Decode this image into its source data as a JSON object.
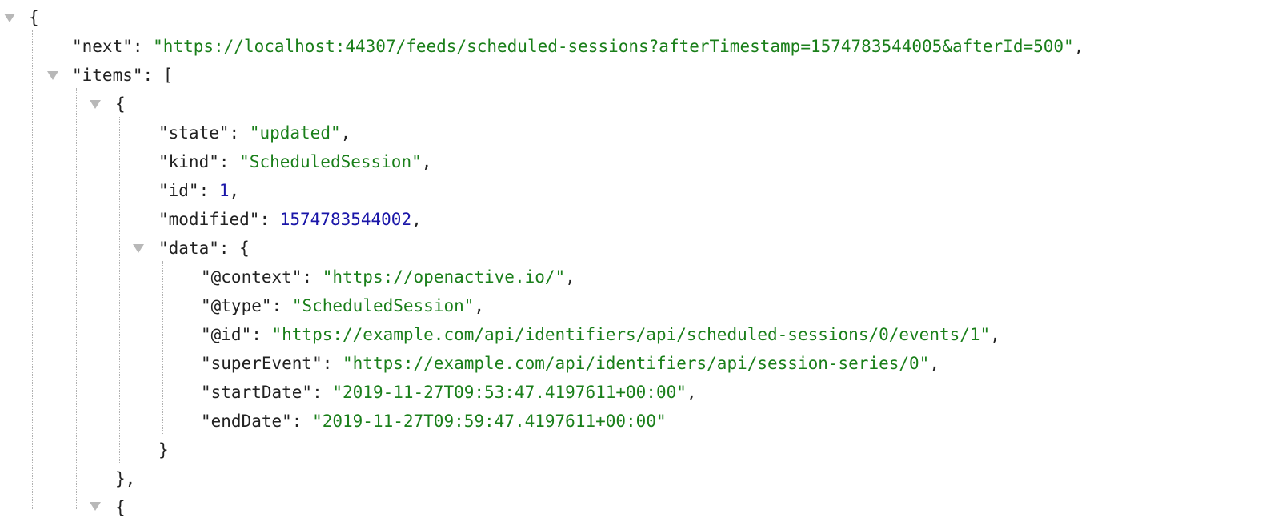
{
  "punct": {
    "open_brace": "{",
    "close_brace": "}",
    "close_brace_comma": "},",
    "open_bracket": "[",
    "colon": ": ",
    "comma": ","
  },
  "root": {
    "next_key": "\"next\"",
    "next_value": "\"https://localhost:44307/feeds/scheduled-sessions?afterTimestamp=1574783544005&afterId=500\"",
    "items_key": "\"items\""
  },
  "item": {
    "state_key": "\"state\"",
    "state_value": "\"updated\"",
    "kind_key": "\"kind\"",
    "kind_value": "\"ScheduledSession\"",
    "id_key": "\"id\"",
    "id_value": "1",
    "modified_key": "\"modified\"",
    "modified_value": "1574783544002",
    "data_key": "\"data\""
  },
  "data": {
    "context_key": "\"@context\"",
    "context_value": "\"https://openactive.io/\"",
    "type_key": "\"@type\"",
    "type_value": "\"ScheduledSession\"",
    "id_key": "\"@id\"",
    "id_value": "\"https://example.com/api/identifiers/api/scheduled-sessions/0/events/1\"",
    "superevent_key": "\"superEvent\"",
    "superevent_value": "\"https://example.com/api/identifiers/api/session-series/0\"",
    "startdate_key": "\"startDate\"",
    "startdate_value": "\"2019-11-27T09:53:47.4197611+00:00\"",
    "enddate_key": "\"endDate\"",
    "enddate_value": "\"2019-11-27T09:59:47.4197611+00:00\""
  },
  "colors": {
    "string": "#1a7f1a",
    "number": "#1a16a8",
    "key": "#222222",
    "toggle": "#b8b8b8"
  },
  "icons": {
    "collapse_toggle": "triangle-down"
  }
}
